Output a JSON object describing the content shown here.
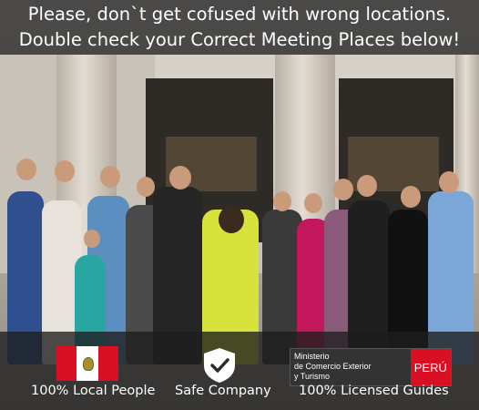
{
  "banner": {
    "line1": "Please, don`t get cofused with wrong locations.",
    "line2": "Double check your Correct Meeting Places below!"
  },
  "badges": {
    "local": {
      "label": "100%  Local People",
      "icon": "peru-flag-icon"
    },
    "safe": {
      "label": "Safe Company",
      "icon": "shield-check-icon"
    },
    "licensed": {
      "label": "100% Licensed Guides",
      "ministry_line1": "Ministerio",
      "ministry_line2": "de Comercio Exterior",
      "ministry_line3": "y Turismo",
      "country": "PERÚ"
    }
  },
  "colors": {
    "banner_bg": "#141414",
    "peru_red": "#d91023",
    "text": "#ffffff"
  }
}
